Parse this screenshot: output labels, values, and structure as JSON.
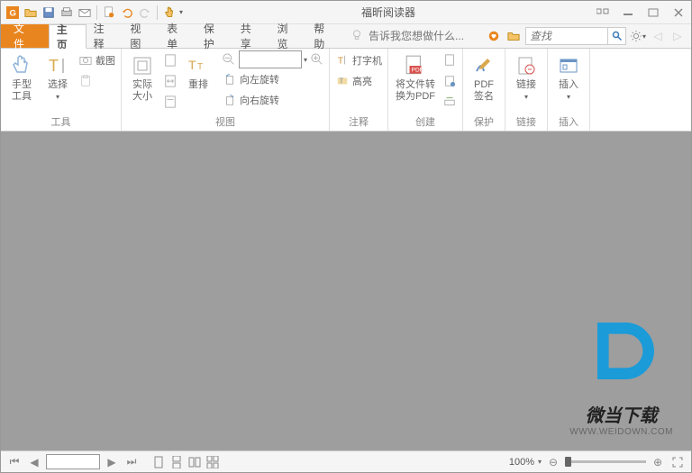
{
  "title": "福昕阅读器",
  "tabs": {
    "file": "文件",
    "home": "主页",
    "comment": "注释",
    "view": "视图",
    "form": "表单",
    "protect": "保护",
    "share": "共享",
    "browse": "浏览",
    "help": "帮助"
  },
  "helpHint": "告诉我您想做什么...",
  "searchPlaceholder": "查找",
  "ribbon": {
    "groups": {
      "tools": "工具",
      "view": "视图",
      "comment": "注释",
      "create": "创建",
      "protect": "保护",
      "links": "链接",
      "insert": "插入"
    },
    "handTool": "手型\n工具",
    "select": "选择",
    "snapshot": "截图",
    "actualSize": "实际\n大小",
    "reflow": "重排",
    "rotateLeft": "向左旋转",
    "rotateRight": "向右旋转",
    "typewriter": "打字机",
    "highlight": "高亮",
    "convertPDF": "将文件转\n换为PDF",
    "pdfSign": "PDF\n签名",
    "link": "链接",
    "insert": "插入"
  },
  "status": {
    "zoom": "100%"
  },
  "watermark": {
    "cn": "微当下载",
    "url": "WWW.WEIDOWN.COM"
  },
  "colors": {
    "accent": "#e9851e",
    "logo": "#1b9bd8"
  }
}
